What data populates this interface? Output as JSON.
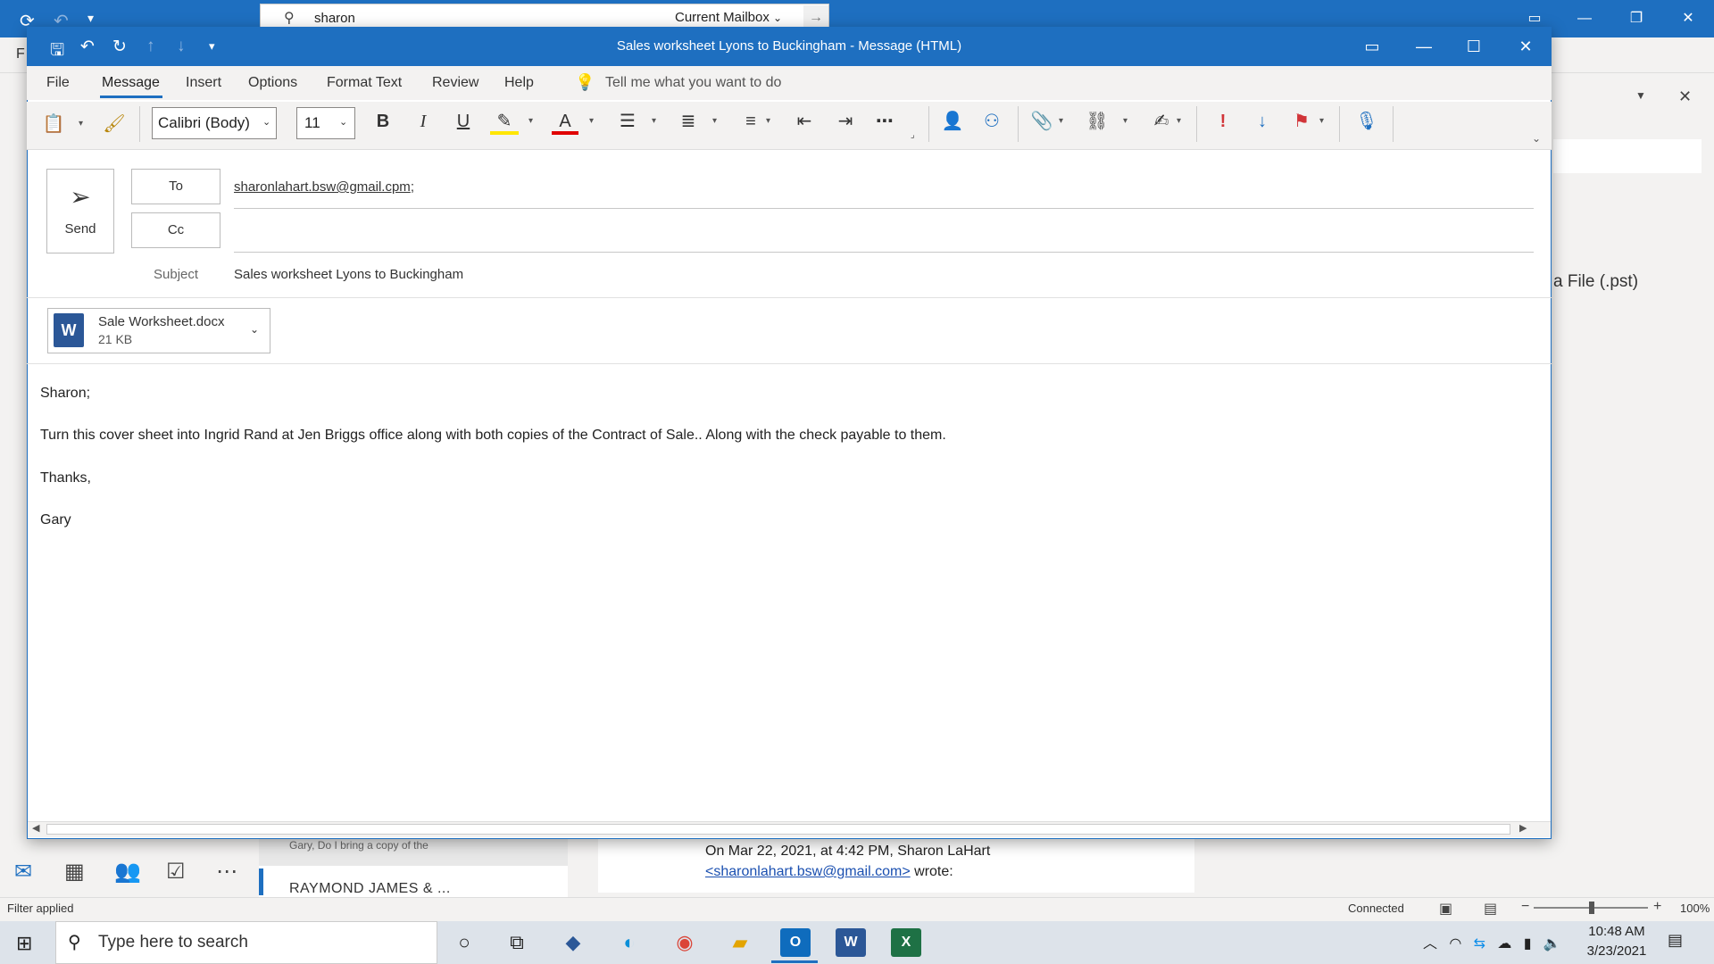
{
  "background": {
    "search_query": "sharon",
    "search_scope": "Current Mailbox",
    "right_pane_text": "a File (.pst)",
    "list_preview_snippet": "Gary,   Do I bring a copy of the",
    "list_sender": "RAYMOND JAMES & ...",
    "reading_line1": "On Mar 22, 2021, at 4:42 PM, Sharon LaHart",
    "reading_line2_link": "<sharonlahart.bsw@gmail.com>",
    "reading_line2_suffix": " wrote:",
    "left_letter": "F"
  },
  "status_bar": {
    "filter": "Filter applied",
    "connection": "Connected",
    "zoom": "100%"
  },
  "compose": {
    "title": "Sales worksheet  Lyons to Buckingham  -  Message (HTML)",
    "menu": [
      "File",
      "Message",
      "Insert",
      "Options",
      "Format Text",
      "Review",
      "Help"
    ],
    "tell_me": "Tell me what you want to do",
    "font_name": "Calibri (Body)",
    "font_size": "11",
    "send_label": "Send",
    "to_label": "To",
    "cc_label": "Cc",
    "to_address": "sharonlahart.bsw@gmail.cpm",
    "to_separator": ";",
    "subject_label": "Subject",
    "subject": "Sales worksheet  Lyons to Buckingham",
    "attachment": {
      "name": "Sale Worksheet.docx",
      "size": "21 KB",
      "icon_letter": "W"
    },
    "body": [
      "Sharon;",
      "Turn this cover sheet into Ingrid Rand at Jen Briggs office along with both copies of the Contract of Sale.. Along with the check payable to them.",
      "Thanks,",
      "Gary"
    ]
  },
  "taskbar": {
    "search_placeholder": "Type here to search",
    "time": "10:48 AM",
    "date": "3/23/2021"
  },
  "colors": {
    "accent": "#1e6fc0",
    "flag_red": "#d13438"
  }
}
